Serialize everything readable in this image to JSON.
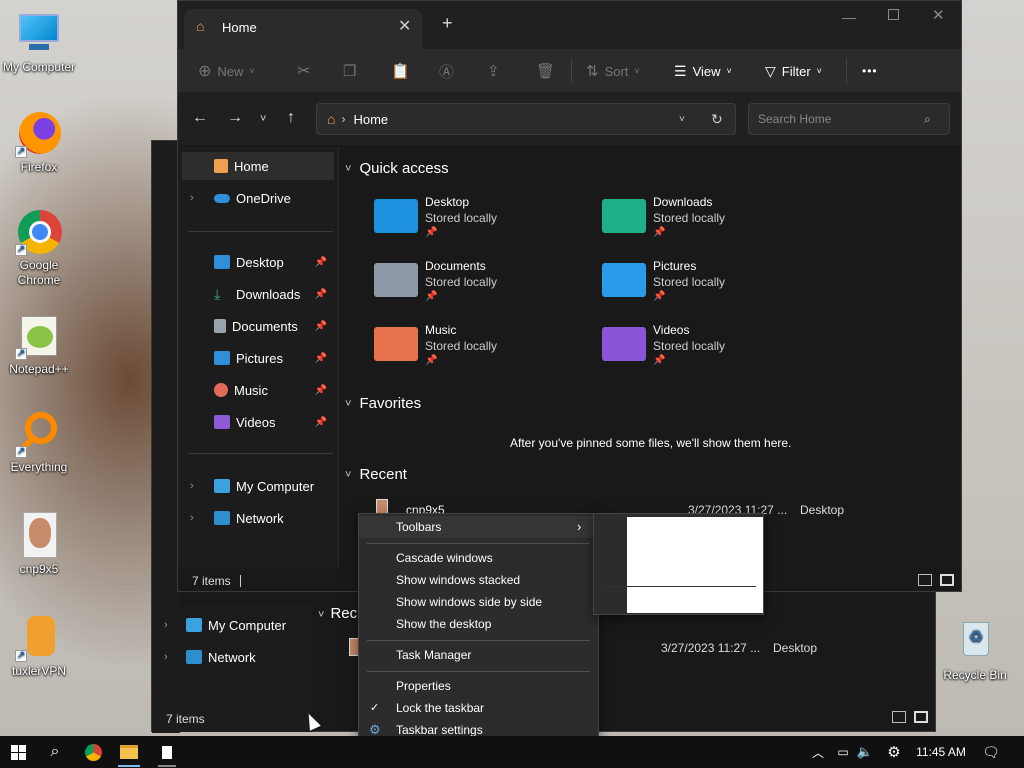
{
  "desktop": {
    "icons": [
      {
        "label": "My Computer"
      },
      {
        "label": "Firefox"
      },
      {
        "label": "Google Chrome"
      },
      {
        "label": "Notepad++"
      },
      {
        "label": "Everything"
      },
      {
        "label": "cnp9x5"
      },
      {
        "label": "tuxlerVPN"
      },
      {
        "label": "Recycle Bin"
      }
    ]
  },
  "back_window": {
    "sidebar": [
      {
        "label": "My Computer"
      },
      {
        "label": "Network"
      }
    ],
    "recent_label": "Rec",
    "recent_row": {
      "date": "3/27/2023 11:27 ...",
      "location": "Desktop"
    },
    "status": "7 items"
  },
  "explorer": {
    "tab_title": "Home",
    "new_tab": "+",
    "toolbar": {
      "new": "New",
      "sort": "Sort",
      "view": "View",
      "filter": "Filter",
      "more": "•••"
    },
    "address": {
      "path": "Home",
      "search_placeholder": "Search Home"
    },
    "sidebar": {
      "home": "Home",
      "onedrive": "OneDrive",
      "pinned": [
        {
          "label": "Desktop",
          "color": "#2f8fd8"
        },
        {
          "label": "Downloads",
          "color": "#2bb673"
        },
        {
          "label": "Documents",
          "color": "#9aa4b0"
        },
        {
          "label": "Pictures",
          "color": "#2f8fd8"
        },
        {
          "label": "Music",
          "color": "#e26a5a"
        },
        {
          "label": "Videos",
          "color": "#8e5bd8"
        }
      ],
      "my_computer": "My Computer",
      "network": "Network"
    },
    "quick_access": {
      "title": "Quick access",
      "items": [
        {
          "name": "Desktop",
          "sub": "Stored locally",
          "color": "#1e90e0"
        },
        {
          "name": "Downloads",
          "sub": "Stored locally",
          "color": "#1fb08a"
        },
        {
          "name": "Documents",
          "sub": "Stored locally",
          "color": "#8f9aa8"
        },
        {
          "name": "Pictures",
          "sub": "Stored locally",
          "color": "#2a9be8"
        },
        {
          "name": "Music",
          "sub": "Stored locally",
          "color": "#e8744f"
        },
        {
          "name": "Videos",
          "sub": "Stored locally",
          "color": "#8a55d8"
        }
      ]
    },
    "favorites": {
      "title": "Favorites",
      "empty": "After you've pinned some files, we'll show them here."
    },
    "recent": {
      "title": "Recent",
      "row": {
        "name": "cnp9x5",
        "date": "3/27/2023 11:27 ...",
        "location": "Desktop"
      }
    },
    "status": "7 items"
  },
  "context_menu": {
    "toolbars": "Toolbars",
    "cascade": "Cascade windows",
    "stacked": "Show windows stacked",
    "side_by_side": "Show windows side by side",
    "show_desktop": "Show the desktop",
    "task_manager": "Task Manager",
    "properties": "Properties",
    "lock": "Lock the taskbar",
    "settings": "Taskbar settings"
  },
  "taskbar": {
    "time": "11:45 AM"
  }
}
